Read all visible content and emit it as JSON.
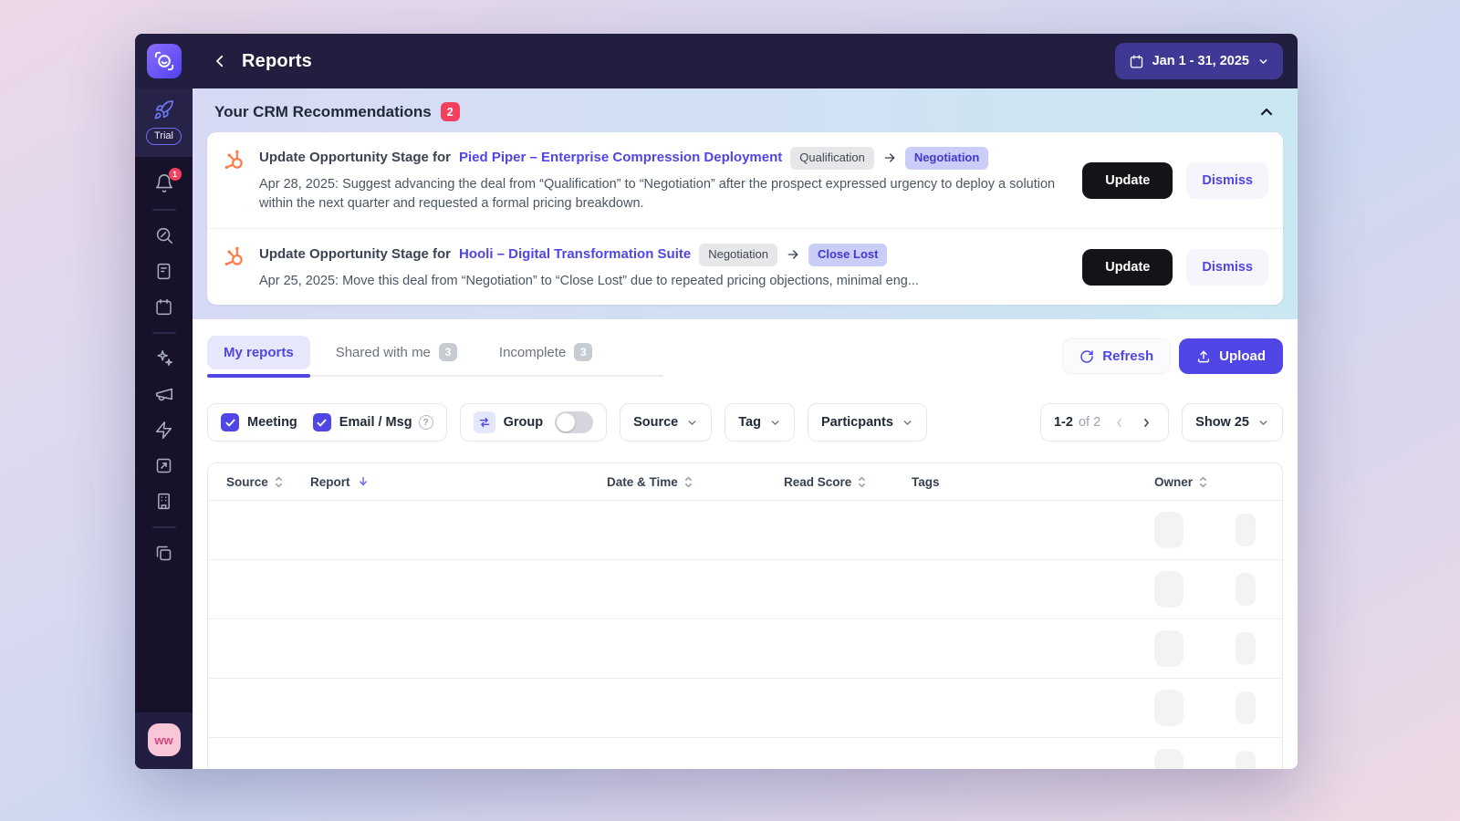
{
  "header": {
    "title": "Reports",
    "date_range": "Jan 1 - 31, 2025"
  },
  "sidebar": {
    "trial_label": "Trial",
    "notification_count": "1",
    "avatar_initials": "ww"
  },
  "recommendations": {
    "title": "Your CRM Recommendations",
    "count": "2",
    "items": [
      {
        "title_prefix": "Update Opportunity Stage for",
        "link": "Pied Piper – Enterprise Compression Deployment",
        "from_stage": "Qualification",
        "to_stage": "Negotiation",
        "description": "Apr 28, 2025: Suggest advancing the deal from “Qualification” to “Negotiation” after the prospect expressed urgency to deploy a solution within the next quarter and requested a formal pricing breakdown.",
        "update_label": "Update",
        "dismiss_label": "Dismiss"
      },
      {
        "title_prefix": "Update Opportunity Stage for",
        "link": "Hooli – Digital Transformation Suite",
        "from_stage": "Negotiation",
        "to_stage": "Close Lost",
        "description": "Apr 25, 2025: Move this deal from “Negotiation” to “Close Lost” due to repeated pricing objections, minimal eng...",
        "update_label": "Update",
        "dismiss_label": "Dismiss"
      }
    ]
  },
  "tabs": {
    "my_reports": "My reports",
    "shared": "Shared with me",
    "shared_count": "3",
    "incomplete": "Incomplete",
    "incomplete_count": "3"
  },
  "actions": {
    "refresh": "Refresh",
    "upload": "Upload"
  },
  "filters": {
    "meeting": "Meeting",
    "email": "Email / Msg",
    "group": "Group",
    "source": "Source",
    "tag": "Tag",
    "participants": "Particpants",
    "pagination_range": "1-2",
    "pagination_of": "of 2",
    "show": "Show 25"
  },
  "table": {
    "headers": [
      "Source",
      "Report",
      "Date & Time",
      "Read Score",
      "Tags",
      "Owner"
    ],
    "skeleton_row_count": 5
  },
  "colors": {
    "accent": "#4F46E5",
    "alert": "#F43F5E",
    "hubspot": "#FF7A45",
    "header_bg": "#221E40"
  }
}
